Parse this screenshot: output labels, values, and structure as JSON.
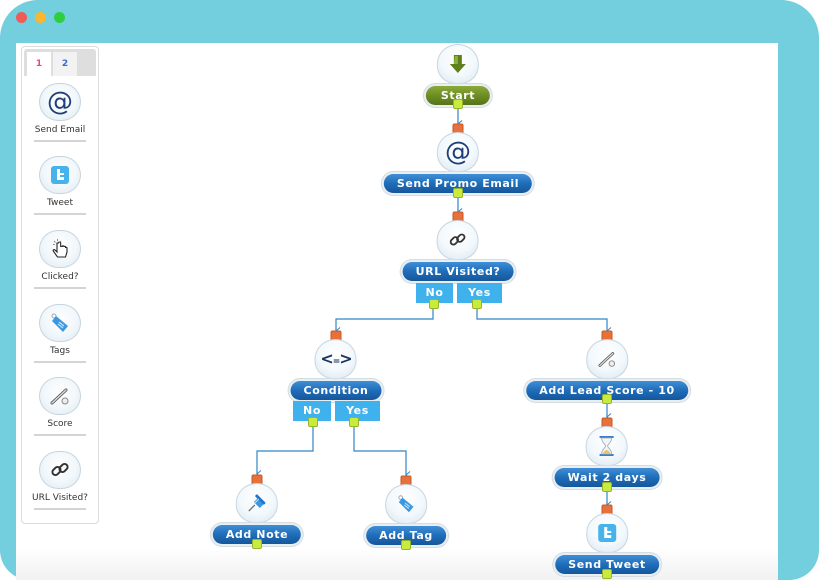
{
  "window": {
    "traffic_lights": [
      {
        "name": "close",
        "color": "#f25a55"
      },
      {
        "name": "minimize",
        "color": "#f7b731"
      },
      {
        "name": "maximize",
        "color": "#2ecf3e"
      }
    ],
    "frame_color": "#73cedd"
  },
  "palette": {
    "tabs": [
      {
        "label": "1",
        "active": true
      },
      {
        "label": "2",
        "active": false
      }
    ],
    "items": [
      {
        "label": "Send Email",
        "icon": "at-sign-icon"
      },
      {
        "label": "Tweet",
        "icon": "twitter-icon"
      },
      {
        "label": "Clicked?",
        "icon": "hand-pointer-icon"
      },
      {
        "label": "Tags",
        "icon": "tag-icon"
      },
      {
        "label": "Score",
        "icon": "thermometer-icon"
      },
      {
        "label": "URL Visited?",
        "icon": "link-icon"
      }
    ]
  },
  "flow": {
    "nodes": {
      "start": {
        "label": "Start",
        "icon": "down-arrow-icon"
      },
      "send_promo_email": {
        "label": "Send Promo Email",
        "icon": "at-sign-icon"
      },
      "url_visited": {
        "label": "URL Visited?",
        "icon": "link-icon",
        "branches": {
          "no": "No",
          "yes": "Yes"
        }
      },
      "condition": {
        "label": "Condition",
        "icon": "compare-icon",
        "branches": {
          "no": "No",
          "yes": "Yes"
        }
      },
      "add_lead_score": {
        "label": "Add Lead Score - 10",
        "icon": "thermometer-icon"
      },
      "wait": {
        "label": "Wait 2 days",
        "icon": "hourglass-icon"
      },
      "send_tweet": {
        "label": "Send Tweet",
        "icon": "twitter-icon"
      },
      "add_note": {
        "label": "Add Note",
        "icon": "pushpin-icon"
      },
      "add_tag": {
        "label": "Add Tag",
        "icon": "tag-icon"
      }
    },
    "colors": {
      "action": "#1f6db9",
      "start": "#6b8b22",
      "branch": "#3fb1ed",
      "input_port": "#e8703a",
      "output_port": "#c9ec3c",
      "wire": "#2f86c6"
    }
  }
}
